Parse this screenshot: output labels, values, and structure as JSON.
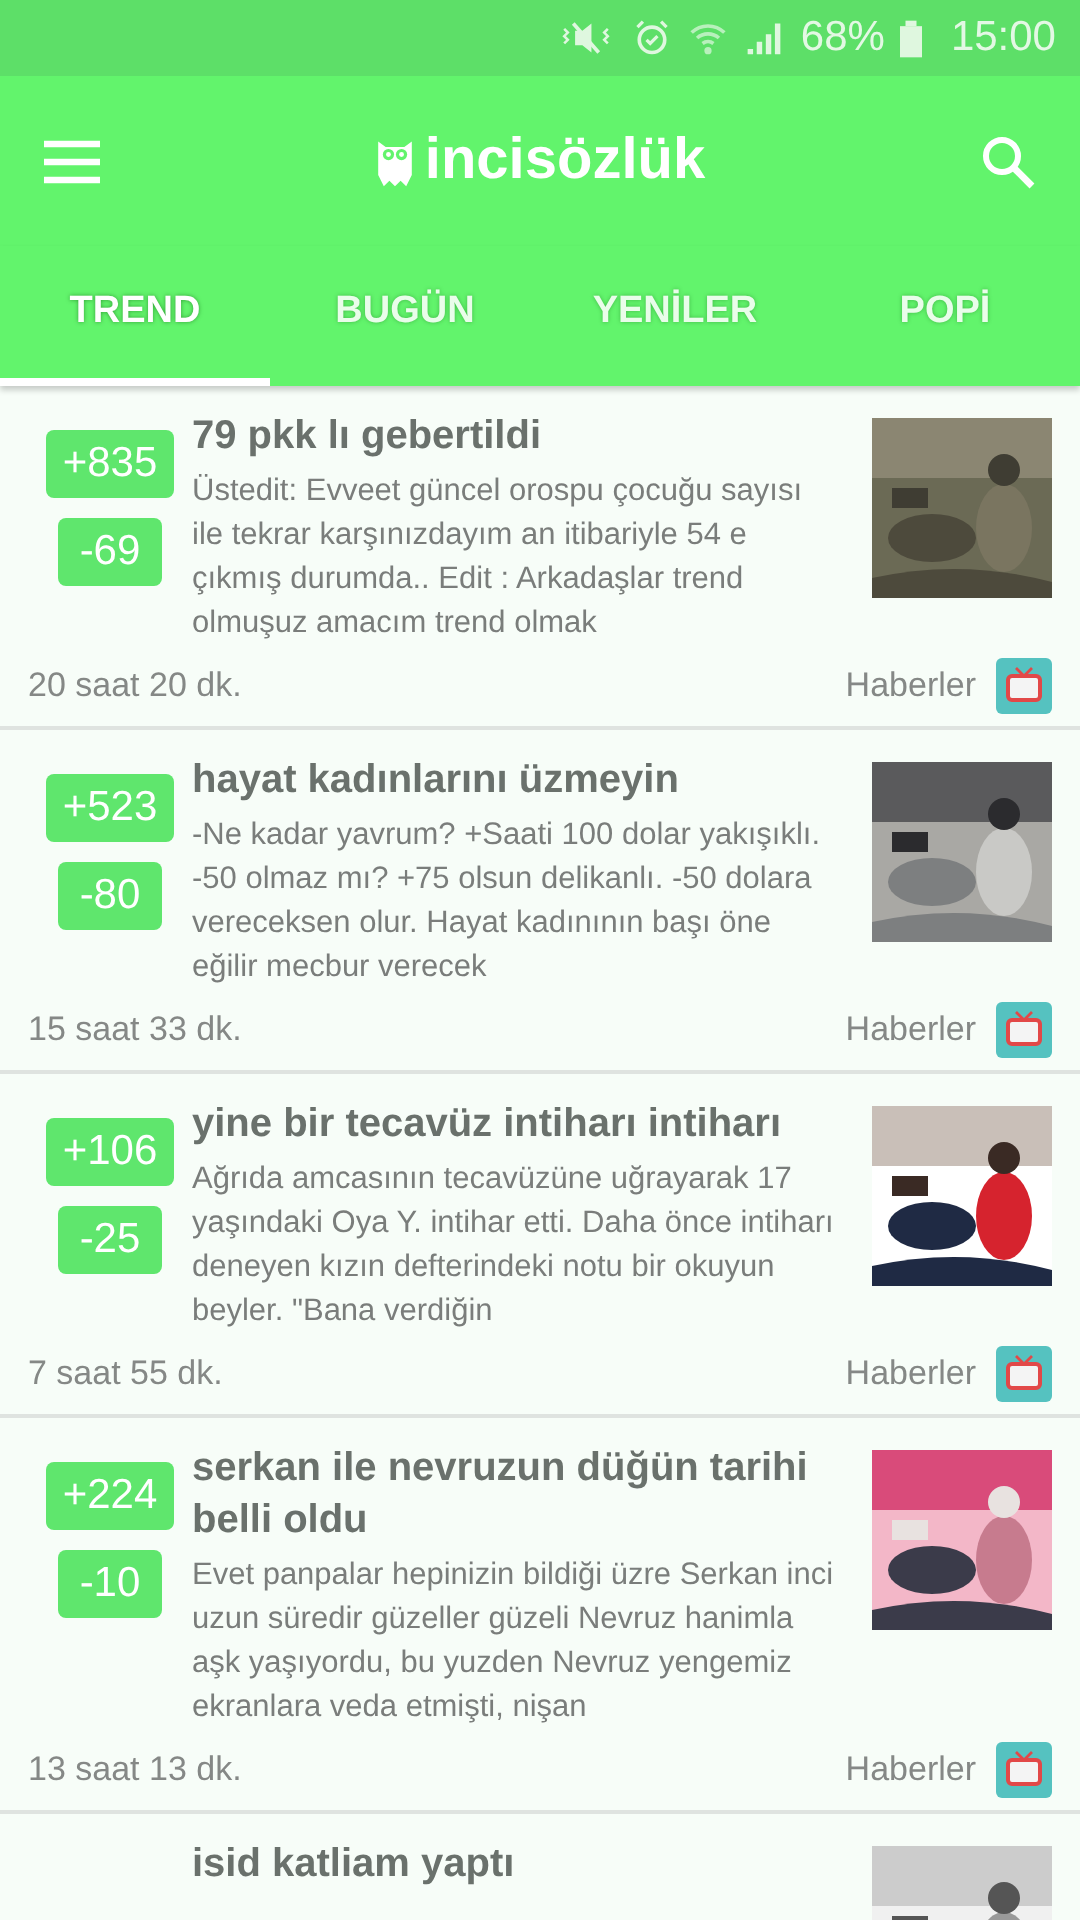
{
  "status_bar": {
    "battery": "68%",
    "time": "15:00"
  },
  "app_bar": {
    "logo": "incisözlük"
  },
  "tabs": [
    {
      "label": "TREND",
      "selected": true
    },
    {
      "label": "BUGÜN",
      "selected": false
    },
    {
      "label": "YENİLER",
      "selected": false
    },
    {
      "label": "POPİ",
      "selected": false
    }
  ],
  "entries": [
    {
      "up": "+835",
      "down": "-69",
      "title": "79 pkk lı gebertildi",
      "excerpt": "Üstedit: Evveet güncel orospu çocuğu sayısı ile tekrar karşınızdayım an itibariyle 54 e çıkmış durumda.. Edit : Arkadaşlar trend olmuşuz amacım trend olmak",
      "time": "20 saat 20 dk.",
      "channel": "Haberler"
    },
    {
      "up": "+523",
      "down": "-80",
      "title": "hayat kadınlarını üzmeyin",
      "excerpt": "-Ne kadar yavrum? +Saati 100 dolar yakışıklı. -50 olmaz mı? +75 olsun delikanlı. -50 dolara vereceksen olur. Hayat kadınının başı öne eğilir mecbur verecek",
      "time": "15 saat 33 dk.",
      "channel": "Haberler"
    },
    {
      "up": "+106",
      "down": "-25",
      "title": "yine bir tecavüz intiharı intiharı",
      "excerpt": "Ağrıda amcasının tecavüzüne uğrayarak 17 yaşındaki Oya Y. intihar etti. Daha önce intiharı deneyen kızın defterindeki notu bir okuyun beyler. \"Bana verdiğin",
      "time": "7 saat 55 dk.",
      "channel": "Haberler"
    },
    {
      "up": "+224",
      "down": "-10",
      "title": "serkan ile nevruzun düğün tarihi belli oldu",
      "excerpt": "Evet panpalar hepinizin bildiği üzre Serkan inci uzun süredir güzeller güzeli Nevruz hanimla aşk yaşıyordu, bu yuzden Nevruz yengemiz ekranlara veda etmişti, nişan",
      "time": "13 saat 13 dk.",
      "channel": "Haberler"
    },
    {
      "title": "isid katliam yaptı"
    }
  ]
}
